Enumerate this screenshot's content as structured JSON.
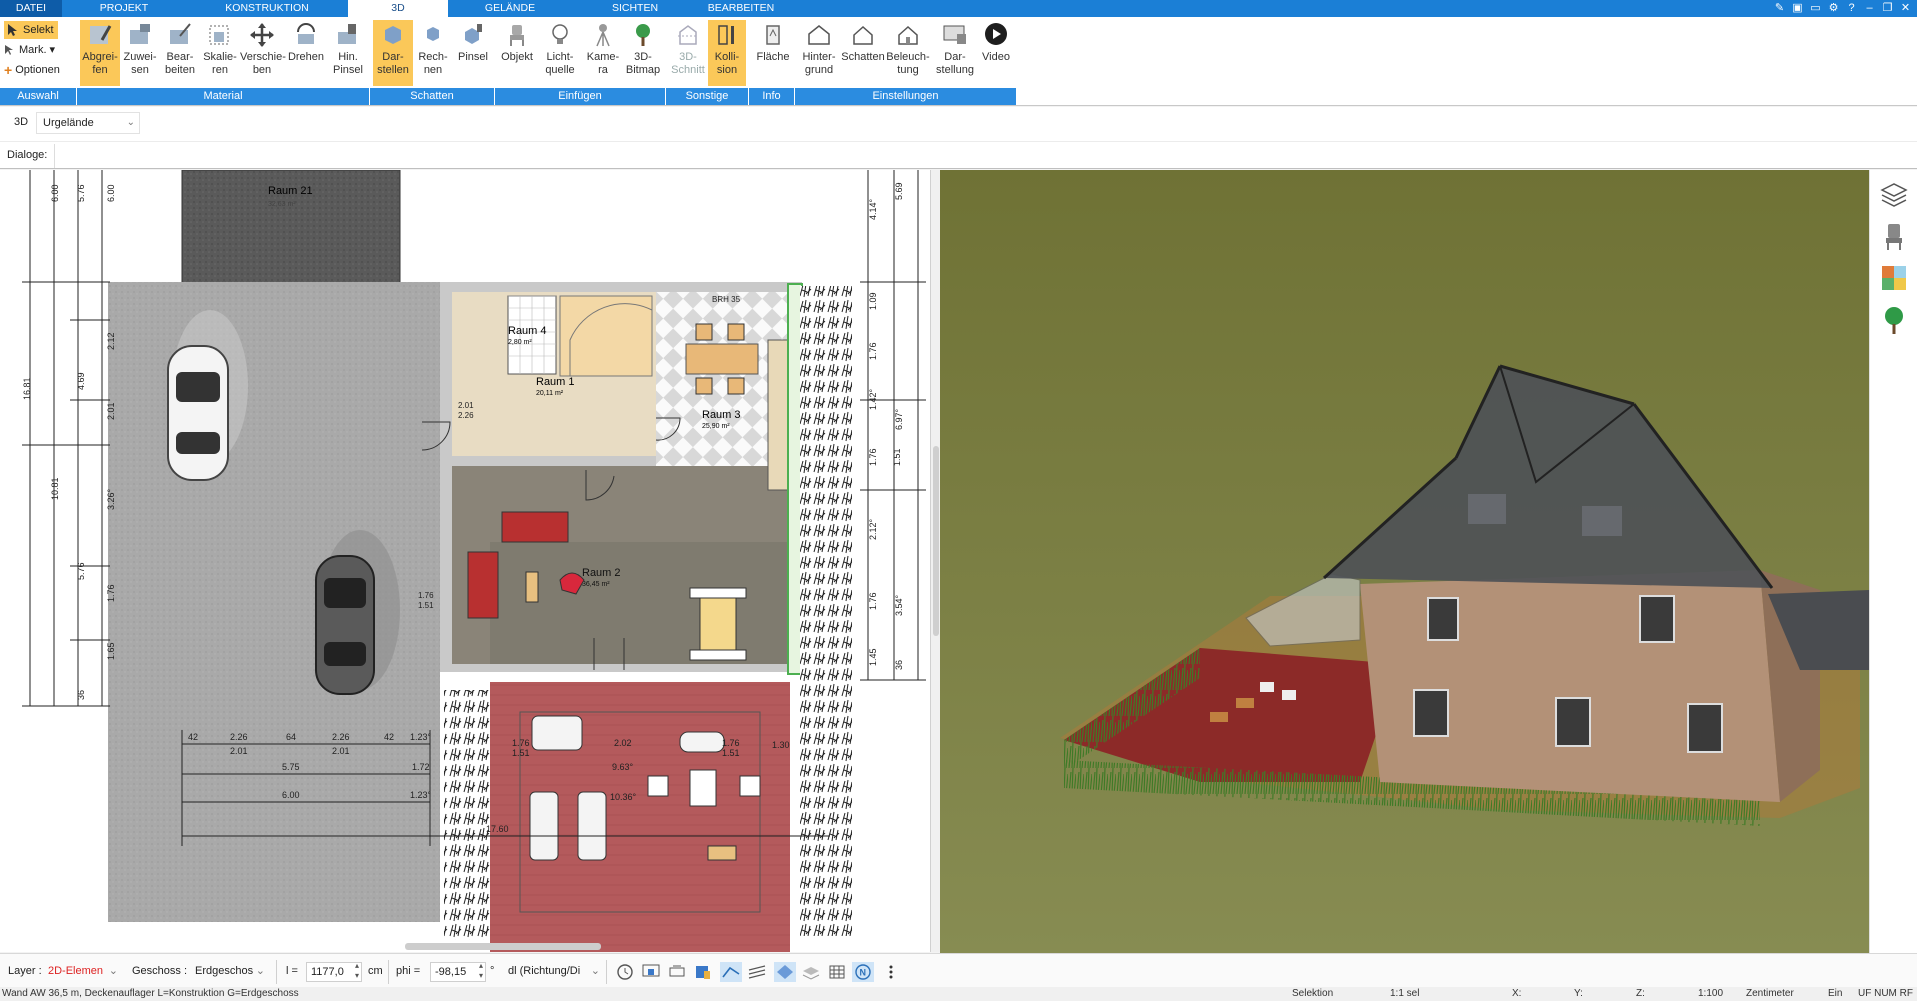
{
  "tabs": [
    "DATEI",
    "PROJEKT",
    "KONSTRUKTION",
    "3D",
    "GELÄNDE",
    "SICHTEN",
    "BEARBEITEN"
  ],
  "active_tab": "3D",
  "ribbon": {
    "auswahl": {
      "selekt": "Selekt",
      "mark": "Mark.",
      "optionen": "Optionen",
      "group": "Auswahl"
    },
    "material": {
      "group": "Material",
      "buttons": [
        "Abgrei-\nfen",
        "Zuwei-\nsen",
        "Bear-\nbeiten",
        "Skalie-\nren",
        "Verschie-\nben",
        "Drehen",
        "Hin.\nPinsel"
      ]
    },
    "schatten": {
      "group": "Schatten",
      "buttons": [
        "Dar-\nstellen",
        "Rech-\nnen",
        "Pinsel"
      ]
    },
    "einfuegen": {
      "group": "Einfügen",
      "buttons": [
        "Objekt",
        "Licht-\nquelle",
        "Kame-\nra",
        "3D-\nBitmap"
      ]
    },
    "sonstige": {
      "group": "Sonstige",
      "buttons": [
        "3D-\nSchnitt",
        "Kolli-\nsion"
      ]
    },
    "info": {
      "group": "Info",
      "buttons": [
        "Fläche"
      ]
    },
    "einstellungen": {
      "group": "Einstellungen",
      "buttons": [
        "Hinter-\ngrund",
        "Schatten",
        "Beleuch-\ntung",
        "Dar-\nstellung",
        "Video"
      ]
    }
  },
  "view_selector": {
    "label": "3D",
    "value": "Urgelände"
  },
  "dialoge_label": "Dialoge:",
  "plan": {
    "rooms": [
      {
        "name": "Raum 21",
        "area": "32,63 m²"
      },
      {
        "name": "Raum 4",
        "area": "2,80 m²"
      },
      {
        "name": "Raum 1",
        "area": "20,11 m²"
      },
      {
        "name": "Raum 3",
        "area": "25,90 m²"
      },
      {
        "name": "Raum 2",
        "area": "36,45 m²"
      }
    ],
    "dims_left": [
      "6.00",
      "5.76",
      "6.00",
      "2.12",
      "4.69",
      "2.01",
      "3.26°",
      "5.76",
      "1.76",
      "1.65",
      "16.81",
      "10.81",
      "36"
    ],
    "dims_right": [
      "5.69",
      "4.14°",
      "1.09",
      "1.76",
      "1.42°",
      "6.97°",
      "1.76",
      "1.51",
      "2.12°",
      "1.76",
      "3.54°",
      "1.45",
      "36"
    ],
    "dims_bottom": [
      "42",
      "2.26",
      "64",
      "2.26",
      "42",
      "1.23°",
      "2.01",
      "2.01",
      "5.75",
      "1.72",
      "6.00",
      "1.23°",
      "1.76",
      "1.51",
      "2.02",
      "1.76",
      "1.51",
      "9.63°",
      "10.36°",
      "17.60",
      "1.30"
    ],
    "small_labels": [
      "2.01",
      "2.26",
      "1.76",
      "1.51",
      "BRH 35"
    ]
  },
  "bottom_toolbar": {
    "layer_label": "Layer :",
    "layer_value": "2D-Elemen",
    "geschoss_label": "Geschoss :",
    "geschoss_value": "Erdgeschos",
    "l_label": "l =",
    "l_value": "1177,0",
    "l_unit": "cm",
    "phi_label": "phi =",
    "phi_value": "-98,15",
    "phi_unit": "°",
    "dl_value": "dl (Richtung/Di"
  },
  "status": {
    "left": "Wand AW 36,5 m, Deckenauflager L=Konstruktion G=Erdgeschoss",
    "mode": "Selektion",
    "sel": "1:1 sel",
    "x": "X:",
    "y": "Y:",
    "z": "Z:",
    "scale": "1:100",
    "unit": "Zentimeter",
    "ein": "Ein",
    "flags": "UF NUM RF"
  },
  "colors": {
    "tab_blue": "#1b7fd6",
    "group_blue": "#2b8ce0",
    "highlight": "#fbc859",
    "grass": "#74793c",
    "paving": "#a8a8a8",
    "terrace": "#b5575a"
  },
  "icons": [
    "select-icon",
    "mark-icon",
    "options-icon",
    "layers-icon",
    "chair-icon",
    "texture-icon",
    "tree-icon",
    "video-icon"
  ]
}
